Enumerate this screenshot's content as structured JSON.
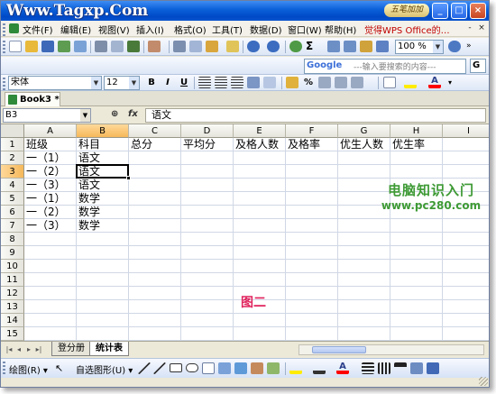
{
  "window": {
    "watermark": "Www.Tagxp.Com",
    "logo_text": "五笔加加",
    "buttons": [
      "_",
      "□",
      "×"
    ]
  },
  "menu": {
    "items": [
      "文件(F)",
      "编辑(E)",
      "视图(V)",
      "插入(I)",
      "格式(O)",
      "工具(T)",
      "数据(D)",
      "窗口(W)",
      "帮助(H)"
    ],
    "wps_promo": "觉得WPS Office的…",
    "doc_controls": [
      "-",
      "×"
    ]
  },
  "standard_toolbar": {
    "zoom": "100 %"
  },
  "google_toolbar": {
    "logo": "Google",
    "placeholder": "---输入要搜索的内容---",
    "end": "G"
  },
  "format_toolbar": {
    "font": "宋体",
    "size": "12",
    "bold": "B",
    "italic": "I",
    "underline": "U",
    "percent": "%"
  },
  "workbook": {
    "tab_label": "Book3 *"
  },
  "formula_bar": {
    "cell_ref": "B3",
    "fx": "fx",
    "content": "语文"
  },
  "grid": {
    "columns": [
      "A",
      "B",
      "C",
      "D",
      "E",
      "F",
      "G",
      "H",
      "I"
    ],
    "rows": [
      "1",
      "2",
      "3",
      "4",
      "5",
      "6",
      "7",
      "8",
      "9",
      "10",
      "11",
      "12",
      "13",
      "14",
      "15"
    ],
    "header_row": [
      "班级",
      "科目",
      "总分",
      "平均分",
      "及格人数",
      "及格率",
      "优生人数",
      "优生率"
    ],
    "data": [
      [
        "一（1）",
        "语文"
      ],
      [
        "一（2）",
        "语文"
      ],
      [
        "一（3）",
        "语文"
      ],
      [
        "一（1）",
        "数学"
      ],
      [
        "一（2）",
        "数学"
      ],
      [
        "一（3）",
        "数学"
      ]
    ],
    "active_cell": "B3"
  },
  "overlays": {
    "site_name": "电脑知识入门",
    "site_url": "www.pc280.com",
    "caption": "图二"
  },
  "sheets": {
    "tabs": [
      "登分册",
      "统计表"
    ],
    "active": "统计表",
    "nav": [
      "|◂",
      "◂",
      "▸",
      "▸|"
    ]
  },
  "draw_toolbar": {
    "draw_label": "绘图(R) ▾",
    "autoshapes_label": "自选图形(U) ▾"
  },
  "colors": {
    "title_bar": "#0a5fd8",
    "caption": "#e0245e",
    "site_logo": "#3e9a35",
    "header_selected": "#f6b85a"
  }
}
